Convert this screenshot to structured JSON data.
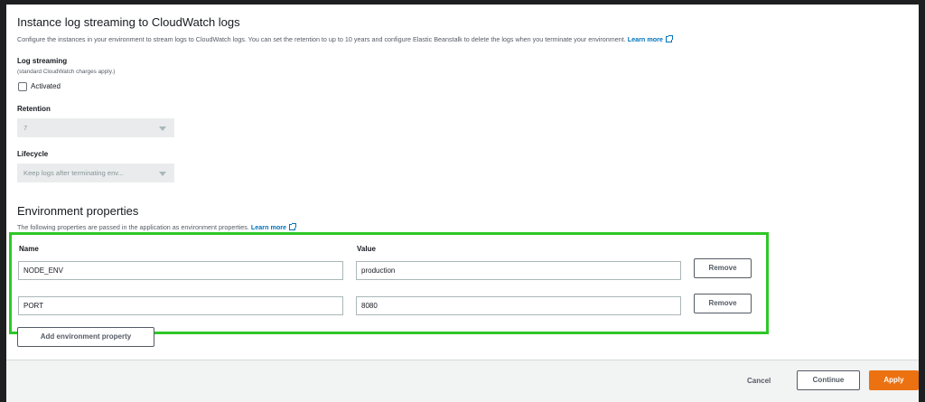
{
  "log_section": {
    "title": "Instance log streaming to CloudWatch logs",
    "description": "Configure the instances in your environment to stream logs to CloudWatch logs. You can set the retention to up to 10 years and configure Elastic Beanstalk to delete the logs when you terminate your environment.",
    "learn_more": "Learn more",
    "log_streaming_label": "Log streaming",
    "log_streaming_note": "(standard CloudWatch charges apply.)",
    "activated_label": "Activated",
    "activated_checked": false,
    "retention_label": "Retention",
    "retention_value": "7",
    "lifecycle_label": "Lifecycle",
    "lifecycle_value": "Keep logs after terminating env..."
  },
  "env_section": {
    "title": "Environment properties",
    "description": "The following properties are passed in the application as environment properties.",
    "learn_more": "Learn more",
    "name_header": "Name",
    "value_header": "Value",
    "rows": [
      {
        "name": "NODE_ENV",
        "value": "production",
        "remove": "Remove"
      },
      {
        "name": "PORT",
        "value": "8080",
        "remove": "Remove"
      }
    ],
    "add_button": "Add environment property"
  },
  "footer": {
    "cancel": "Cancel",
    "continue": "Continue",
    "apply": "Apply"
  },
  "colors": {
    "highlight": "#2ec727",
    "primary": "#ec7211",
    "link": "#0073bb"
  }
}
